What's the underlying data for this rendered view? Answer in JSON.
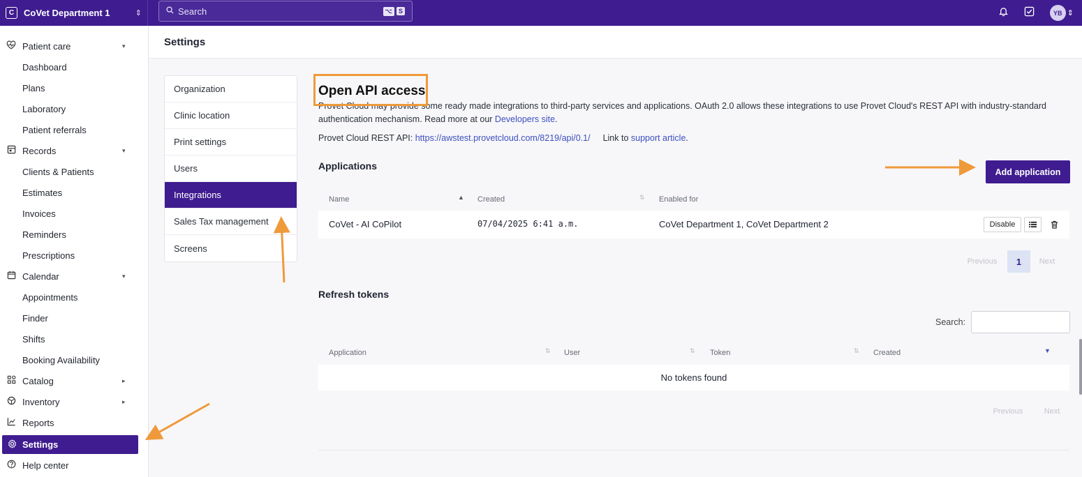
{
  "topbar": {
    "logo_letter": "C",
    "department": "CoVet Department 1",
    "dept_chevron": "⇕",
    "search_icon": "search-icon",
    "search_placeholder": "Search",
    "search_kbd": [
      "⌥",
      "S"
    ],
    "notifications_icon": "bell-icon",
    "tasks_icon": "checkbox-icon",
    "avatar_initials": "YB"
  },
  "sidebar": {
    "items": [
      {
        "label": "Patient care",
        "icon": "heart-pulse-icon",
        "expandable": "▾"
      },
      {
        "label": "Dashboard"
      },
      {
        "label": "Plans"
      },
      {
        "label": "Laboratory"
      },
      {
        "label": "Patient referrals"
      },
      {
        "label": "Records",
        "icon": "records-icon",
        "expandable": "▾"
      },
      {
        "label": "Clients & Patients"
      },
      {
        "label": "Estimates"
      },
      {
        "label": "Invoices"
      },
      {
        "label": "Reminders"
      },
      {
        "label": "Prescriptions"
      },
      {
        "label": "Calendar",
        "icon": "calendar-icon",
        "expandable": "▾"
      },
      {
        "label": "Appointments"
      },
      {
        "label": "Finder"
      },
      {
        "label": "Shifts"
      },
      {
        "label": "Booking Availability"
      },
      {
        "label": "Catalog",
        "icon": "catalog-icon",
        "expandable": "▸"
      },
      {
        "label": "Inventory",
        "icon": "inventory-icon",
        "expandable": "▸"
      },
      {
        "label": "Reports",
        "icon": "reports-icon"
      },
      {
        "label": "Settings",
        "icon": "gear-icon"
      },
      {
        "label": "Help center",
        "icon": "help-icon"
      }
    ]
  },
  "header": {
    "title": "Settings"
  },
  "settings_nav": {
    "items": [
      {
        "label": "Organization"
      },
      {
        "label": "Clinic location"
      },
      {
        "label": "Print settings"
      },
      {
        "label": "Users"
      },
      {
        "label": "Integrations"
      },
      {
        "label": "Sales Tax management"
      },
      {
        "label": "Screens"
      }
    ],
    "active_index": 4
  },
  "api": {
    "title": "Open API access",
    "desc_part1": "Provet Cloud may provide some ready made integrations to third-party services and applications. OAuth 2.0 allows these integrations to use Provet Cloud's REST API with industry-standard authentication mechanism. Read more at our ",
    "desc_link": "Developers site",
    "desc_end": ".",
    "rest_label": "Provet Cloud REST API: ",
    "rest_url": "https://awstest.provetcloud.com/8219/api/0.1/",
    "support_prefix": "Link to ",
    "support_link": "support article",
    "support_end": "."
  },
  "applications": {
    "title": "Applications",
    "add_button": "Add application",
    "columns": [
      "Name",
      "Created",
      "Enabled for"
    ],
    "rows": [
      {
        "name": "CoVet - AI CoPilot",
        "created": "07/04/2025 6:41 a.m.",
        "enabled_for": "CoVet Department 1, CoVet Department 2"
      }
    ],
    "disable_label": "Disable",
    "list_icon": "list-icon",
    "trash_icon": "trash-icon",
    "pager": {
      "prev": "Previous",
      "page": "1",
      "next": "Next"
    }
  },
  "tokens": {
    "title": "Refresh tokens",
    "search_label": "Search:",
    "columns": [
      "Application",
      "User",
      "Token",
      "Created"
    ],
    "empty": "No tokens found",
    "pager": {
      "prev": "Previous",
      "next": "Next"
    }
  },
  "colors": {
    "brand": "#3f1c8f",
    "annotation": "#ef9a3a",
    "link": "#3d4fbf"
  }
}
